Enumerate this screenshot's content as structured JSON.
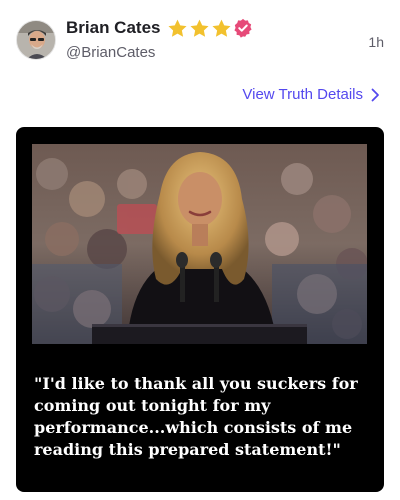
{
  "post": {
    "author": {
      "display_name": "Brian Cates",
      "handle": "@BrianCates",
      "badges": [
        "star-icon",
        "star-icon",
        "star-icon",
        "verified-badge-icon"
      ],
      "badge_colors": {
        "star": "#f2c12e",
        "verified": "#e64a78"
      }
    },
    "timestamp": "1h",
    "details_link": {
      "label": "View Truth Details",
      "icon": "chevron-right-icon",
      "color": "#5448ee"
    },
    "media": {
      "photo_description": "photo",
      "quote_text": "\"I'd like to thank all you suckers for coming out tonight for my performance...which consists of me reading this prepared statement!\""
    }
  }
}
